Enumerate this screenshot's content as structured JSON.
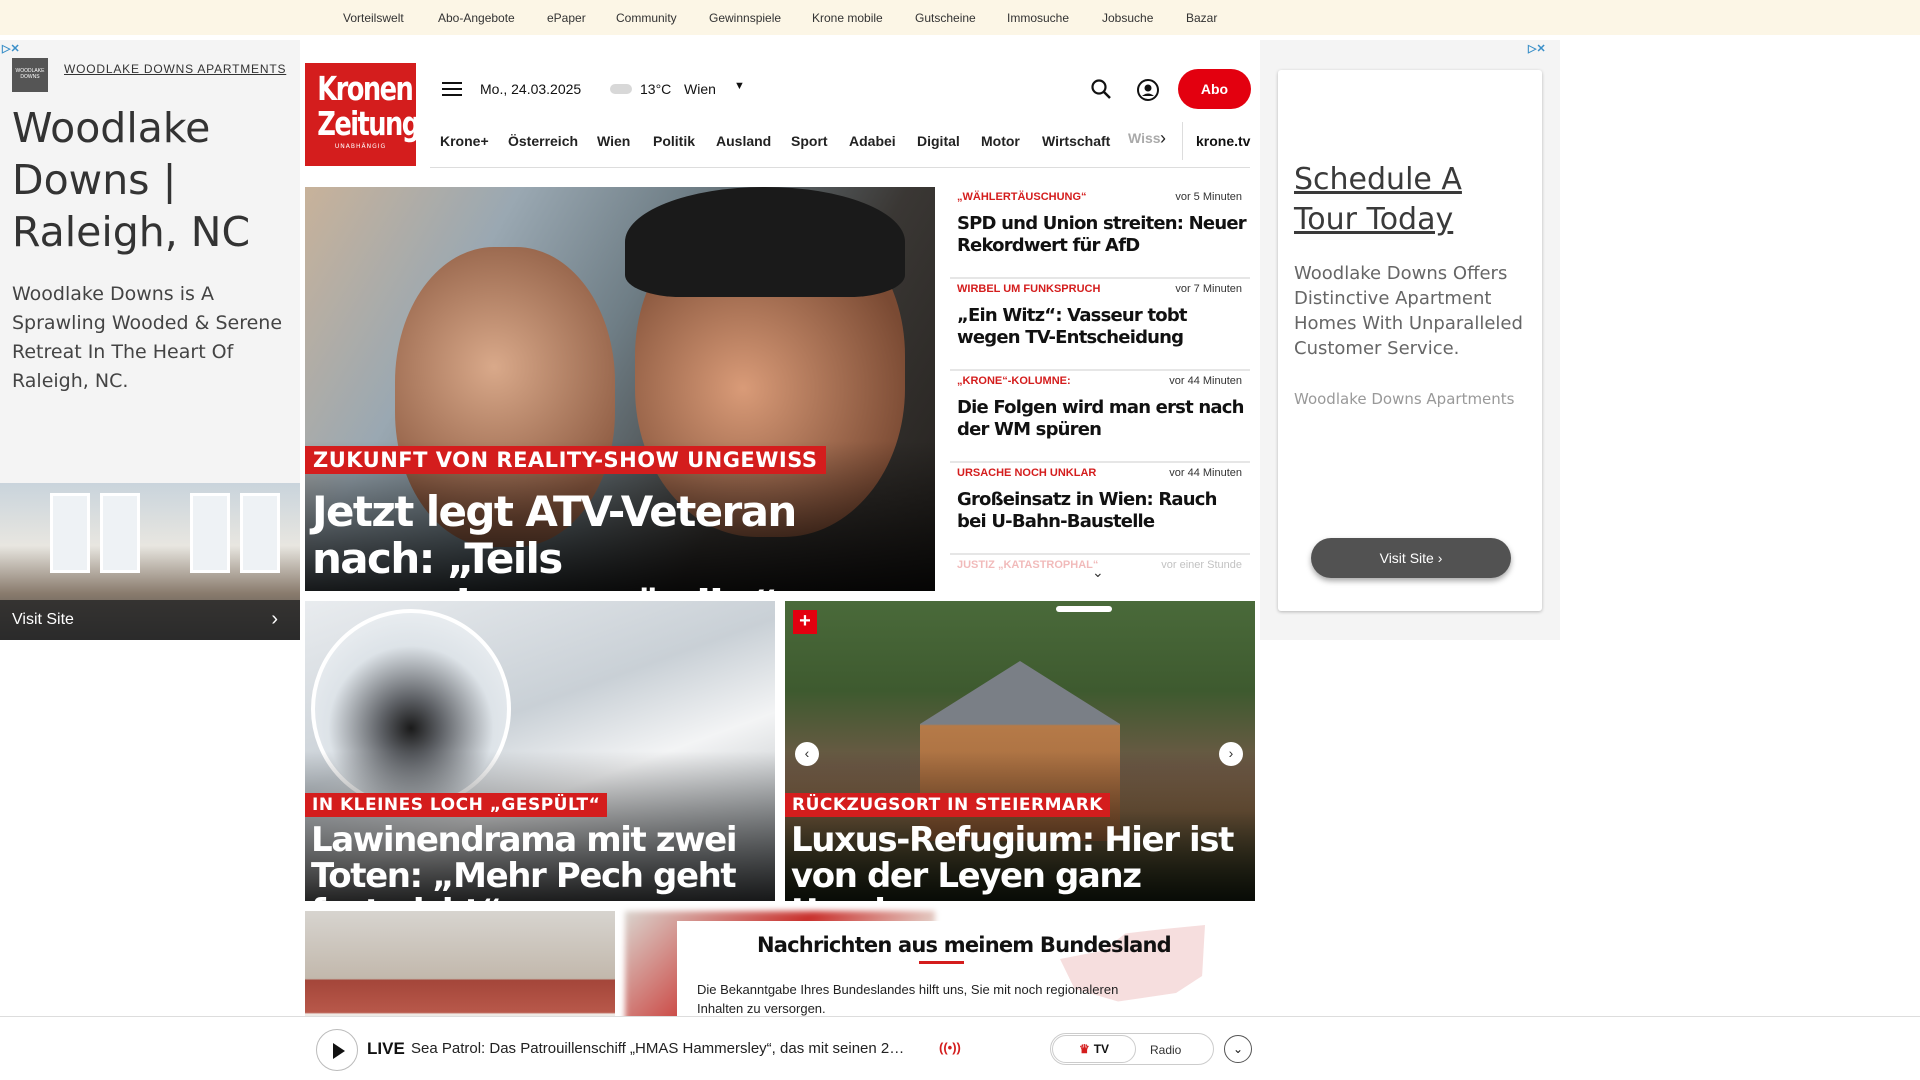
{
  "topbar": {
    "items": [
      "Vorteilswelt",
      "Abo-Angebote",
      "ePaper",
      "Community",
      "Gewinnspiele",
      "Krone mobile",
      "Gutscheine",
      "Immosuche",
      "Jobsuche",
      "Bazar"
    ]
  },
  "ad_left": {
    "brand": "WOODLAKE DOWNS APARTMENTS",
    "title": "Woodlake Downs | Raleigh, NC",
    "body": "Woodlake Downs is A Sprawling Wooded & Serene Retreat In The Heart Of Raleigh, NC.",
    "cta": "Visit Site"
  },
  "ad_right": {
    "title": "Schedule A Tour Today",
    "body": "Woodlake Downs Offers Distinctive Apartment Homes With Unparalleled Customer Service.",
    "brand": "Woodlake Downs Apartments",
    "cta": "Visit Site"
  },
  "header": {
    "logo_line1": "Kronen",
    "logo_line2": "Zeitung",
    "logo_tagline": "UNABHÄNGIG",
    "date": "Mo., 24.03.2025",
    "temperature": "13°C",
    "city": "Wien",
    "abo_label": "Abo"
  },
  "nav": {
    "items": [
      "Krone+",
      "Österreich",
      "Wien",
      "Politik",
      "Ausland",
      "Sport",
      "Adabei",
      "Digital",
      "Motor",
      "Wirtschaft"
    ],
    "faded": "Wiss",
    "tv": "krone.tv"
  },
  "hero": {
    "kicker": "ZUKUNFT VON REALITY-SHOW UNGEWISS",
    "title": "Jetzt legt ATV-Veteran nach: „Teils menschenunwürdig“"
  },
  "ticker": [
    {
      "kicker": "„WÄHLERTÄUSCHUNG“",
      "time": "vor 5 Minuten",
      "title": "SPD und Union streiten: Neuer Rekordwert für AfD"
    },
    {
      "kicker": "WIRBEL UM FUNKSPRUCH",
      "time": "vor 7 Minuten",
      "title": "„Ein Witz“: Vasseur tobt wegen TV-Entscheidung"
    },
    {
      "kicker": "„KRONE“-KOLUMNE:",
      "time": "vor 44 Minuten",
      "title": "Die Folgen wird man erst nach der WM spüren"
    },
    {
      "kicker": "URSACHE NOCH UNKLAR",
      "time": "vor 44 Minuten",
      "title": "Großeinsatz in Wien: Rauch bei U-Bahn-Baustelle"
    },
    {
      "kicker": "JUSTIZ „KATASTROPHAL“",
      "time": "vor einer Stunde",
      "title": ""
    }
  ],
  "cards": [
    {
      "kicker": "IN KLEINES LOCH „GESPÜLT“",
      "title": "Lawinendrama mit zwei Toten: „Mehr Pech geht fast nicht“"
    },
    {
      "kicker": "RÜCKZUGSORT IN STEIERMARK",
      "title": "Luxus-Refugium: Hier ist von der Leyen ganz Ursula"
    }
  ],
  "bundesland": {
    "title": "Nachrichten aus meinem Bundesland",
    "text": "Die Bekanntgabe Ihres Bundeslandes hilft uns, Sie mit noch regionaleren Inhalten zu versorgen."
  },
  "live": {
    "label": "LIVE",
    "text": "Sea Patrol: Das Patrouillenschiff „HMAS Hammersley“, das mit seinen 2…",
    "tv": "TV",
    "radio": "Radio"
  },
  "colors": {
    "brand_red": "#d41d1d",
    "abo_red": "#e3000f",
    "topbar_bg": "#fcf6e6"
  }
}
